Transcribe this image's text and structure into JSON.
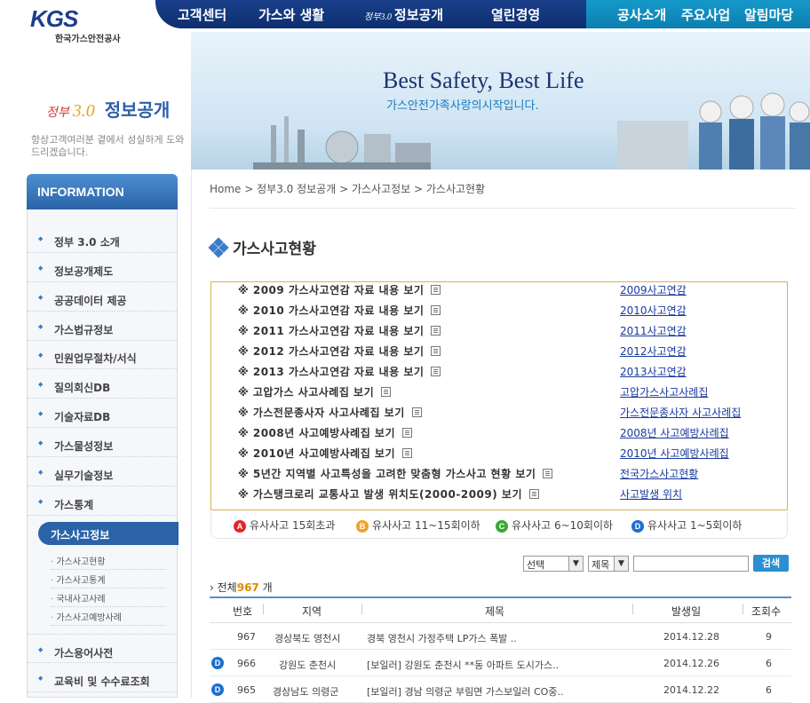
{
  "logo": {
    "mark": "KGS",
    "sub": "한국가스안전공사"
  },
  "gnb": {
    "items": [
      "고객센터",
      "가스와 생활",
      "정부3.0 정보공개",
      "열린경영"
    ],
    "gov_prefix": "정부3.0",
    "gov_label": "정보공개"
  },
  "util_nav": {
    "items": [
      "공사소개",
      "주요사업",
      "알림마당"
    ]
  },
  "hero": {
    "slogan": "Best Safety, Best Life",
    "tagline": "가스안전가족사랑의시작입니다."
  },
  "left_panel": {
    "gov_prefix": "정부",
    "gov_num": "3.0",
    "gov_title": "정보공개",
    "desc": "항상고객여러분 곁에서 성실하게 도와드리겠습니다."
  },
  "sidebar": {
    "title": "INFORMATION",
    "items": [
      "정부 3.0 소개",
      "정보공개제도",
      "공공데이터 제공",
      "가스법규정보",
      "민원업무절차/서식",
      "질의회신DB",
      "기술자료DB",
      "가스물성정보",
      "실무기술정보",
      "가스통계"
    ],
    "active": "가스사고정보",
    "subitems": [
      "가스사고현황",
      "가스사고통계",
      "국내사고사례",
      "가스사고예방사례"
    ],
    "after": [
      "가스용어사전",
      "교육비 및 수수료조회"
    ]
  },
  "breadcrumb": "Home > 정부3.0 정보공개 > 가스사고정보 > 가스사고현황",
  "page_title": "가스사고현황",
  "links": [
    {
      "text": "※ 2009 가스사고연감 자료 내용 보기",
      "link": "2009사고연감"
    },
    {
      "text": "※ 2010 가스사고연감 자료 내용 보기",
      "link": "2010사고연감"
    },
    {
      "text": "※ 2011 가스사고연감 자료 내용 보기",
      "link": "2011사고연감"
    },
    {
      "text": "※ 2012 가스사고연감 자료 내용 보기",
      "link": "2012사고연감"
    },
    {
      "text": "※ 2013 가스사고연감 자료 내용 보기",
      "link": "2013사고연감"
    },
    {
      "text": "※ 고압가스 사고사례집 보기",
      "link": "고압가스사고사례집"
    },
    {
      "text": "※ 가스전문종사자 사고사례집 보기",
      "link": "가스전문종사자 사고사례집"
    },
    {
      "text": "※ 2008년 사고예방사례집 보기",
      "link": "2008년 사고예방사례집"
    },
    {
      "text": "※ 2010년 사고예방사례집 보기",
      "link": "2010년 사고예방사례집"
    },
    {
      "text": "※ 5년간 지역별 사고특성을 고려한 맞춤형 가스사고 현황 보기",
      "link": "전국가스사고현황"
    },
    {
      "text": "※ 가스탱크로리 교통사고 발생 위치도(2000-2009) 보기",
      "link": "사고발생 위치"
    }
  ],
  "legend": [
    {
      "badge": "A",
      "color": "#e0262b",
      "text": "유사사고 15회초과"
    },
    {
      "badge": "B",
      "color": "#f2a12a",
      "text": "유사사고 11~15회이하"
    },
    {
      "badge": "C",
      "color": "#3aa935",
      "text": "유사사고 6~10회이하"
    },
    {
      "badge": "D",
      "color": "#1d6fd1",
      "text": "유사사고 1~5회이하"
    }
  ],
  "search": {
    "select1": "선택",
    "select2": "제목",
    "button": "검색",
    "input_value": ""
  },
  "total": {
    "prefix": "전체",
    "count": "967",
    "suffix": "개"
  },
  "table": {
    "headers": [
      "번호",
      "지역",
      "제목",
      "발생일",
      "조회수"
    ],
    "rows": [
      {
        "badge": "",
        "no": "967",
        "region": "경상북도 영천시",
        "title": "경북 영천시 가정주택 LP가스 폭발 ..",
        "date": "2014.12.28",
        "views": "9"
      },
      {
        "badge": "D",
        "no": "966",
        "region": "강원도 춘천시",
        "title": "[보일러] 강원도 춘천시 **동 아파트 도시가스..",
        "date": "2014.12.26",
        "views": "6"
      },
      {
        "badge": "D",
        "no": "965",
        "region": "경상남도 의령군",
        "title": "[보일러] 경남 의령군 부림면 가스보일러 CO중..",
        "date": "2014.12.22",
        "views": "6"
      }
    ]
  }
}
